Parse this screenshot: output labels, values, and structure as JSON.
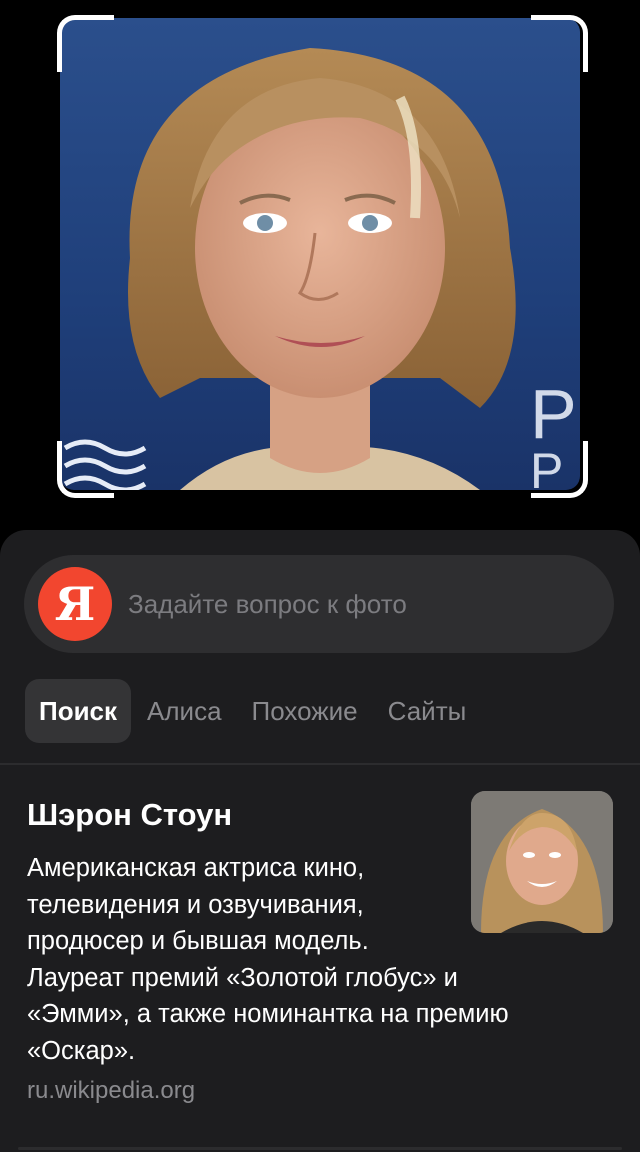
{
  "search": {
    "logo_letter": "Я",
    "placeholder": "Задайте вопрос к фото"
  },
  "tabs": [
    {
      "label": "Поиск",
      "active": true
    },
    {
      "label": "Алиса",
      "active": false
    },
    {
      "label": "Похожие",
      "active": false
    },
    {
      "label": "Сайты",
      "active": false
    }
  ],
  "result": {
    "title": "Шэрон Стоун",
    "description_lines": [
      "Американская актриса кино,",
      "телевидения и озвучивания,",
      "продюсер и бывшая модель.",
      "Лауреат премий «Золотой глобус» и",
      "«Эмми», а также номинантка на премию",
      "«Оскар»."
    ],
    "source": "ru.wikipedia.org"
  },
  "colors": {
    "background": "#000000",
    "sheet": "#1d1d1f",
    "search_bar": "#2e2e30",
    "logo": "#f2462f",
    "muted_text": "#8a8a8e"
  },
  "icons": {
    "logo": "yandex-logo-icon",
    "crop": "crop-frame-icon"
  }
}
